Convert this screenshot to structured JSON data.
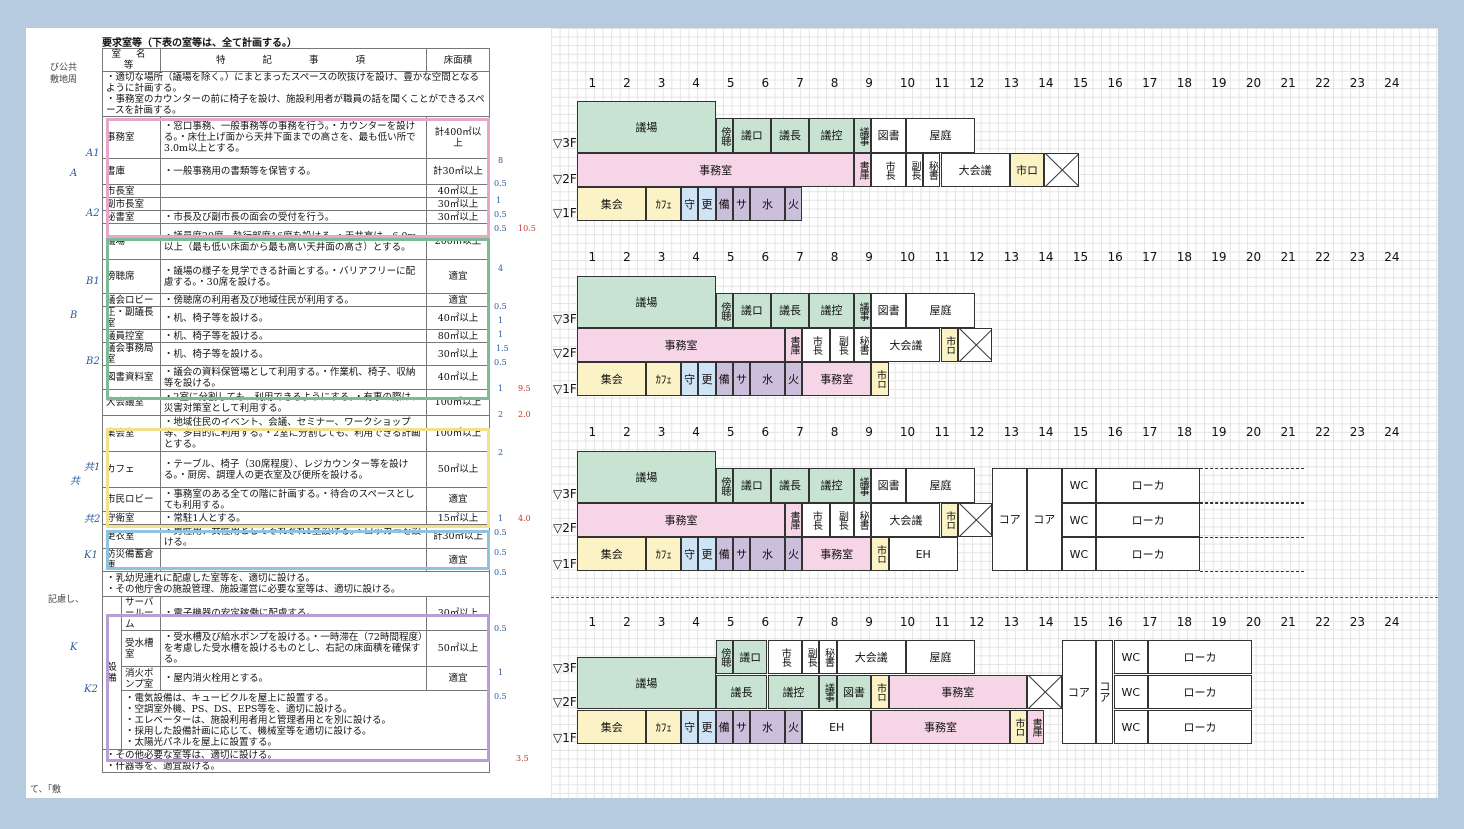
{
  "left": {
    "title": "要求室等（下表の室等は、全て計画する。）",
    "headers": [
      "室 名 等",
      "特　　記　　事　　項",
      "床面積"
    ],
    "intro": [
      "・適切な場所（議場を除く。）にまとまったスペースの吹抜けを設け、豊かな空間となるように計画する。",
      "・事務室のカウンターの前に椅子を設け、施設利用者が職員の話を聞くことができるスペースを計画する。"
    ],
    "rows": [
      {
        "name": "事務室",
        "note": "・窓口事務、一般事務等の事務を行う。・カウンターを設ける。・床仕上げ面から天井下面までの高さを、最も低い所で3.0m以上とする。",
        "area": "計400㎡以上"
      },
      {
        "name": "書庫",
        "note": "・一般事務用の書類等を保管する。",
        "area": "計30㎡以上"
      },
      {
        "name": "市長室",
        "note": "",
        "area": "40㎡以上"
      },
      {
        "name": "副市長室",
        "note": "",
        "area": "30㎡以上"
      },
      {
        "name": "秘書室",
        "note": "・市長及び副市長の面会の受付を行う。",
        "area": "30㎡以上"
      },
      {
        "name": "議場",
        "note": "・議員席20席、執行部席16席を設ける。・天井高は、6.0m以上（最も低い床面から最も高い天井面の高さ）とする。",
        "area": "200㎡以上"
      },
      {
        "name": "傍聴席",
        "note": "・議場の様子を見学できる計画とする。・バリアフリーに配慮する。・30席を設ける。",
        "area": "適宜"
      },
      {
        "name": "議会ロビー",
        "note": "・傍聴席の利用者及び地域住民が利用する。",
        "area": "適宜"
      },
      {
        "name": "正・副議長室",
        "note": "・机、椅子等を設ける。",
        "area": "40㎡以上"
      },
      {
        "name": "議員控室",
        "note": "・机、椅子等を設ける。",
        "area": "80㎡以上"
      },
      {
        "name": "議会事務局室",
        "note": "・机、椅子等を設ける。",
        "area": "30㎡以上"
      },
      {
        "name": "図書資料室",
        "note": "・議会の資料保管場として利用する。・作業机、椅子、収納等を設ける。",
        "area": "40㎡以上"
      },
      {
        "name": "大会議室",
        "note": "・2室に分割しても、利用できるようにする。・有事の際は、災害対策室として利用する。",
        "area": "100㎡以上"
      },
      {
        "name": "集会室",
        "note": "・地域住民のイベント、会議、セミナー、ワークショップ等、多目的に利用する。・2室に分割しても、利用できる計画とする。",
        "area": "100㎡以上"
      },
      {
        "name": "カフェ",
        "note": "・テーブル、椅子（30席程度）、レジカウンター等を設ける。・厨房、調理人の更衣室及び便所を設ける。",
        "area": "50㎡以上"
      },
      {
        "name": "市民ロビー",
        "note": "・事務室のある全ての階に計画する。・待合のスペースとしても利用する。",
        "area": "適宜"
      },
      {
        "name": "守衛室",
        "note": "・常駐1人とする。",
        "area": "15㎡以上"
      },
      {
        "name": "更衣室",
        "note": "・男性用、女性用としてそれぞれ1室設ける。・ロッカーを設ける。",
        "area": "計30㎡以上"
      },
      {
        "name": "防災備蓄倉庫",
        "note": "",
        "area": "適宜"
      }
    ],
    "misc": [
      "・乳幼児連れに配慮した室等を、適切に設ける。",
      "・その他庁舎の施設管理、施設運営に必要な室等は、適切に設ける。"
    ],
    "setsubi_label": "設備",
    "setsubi_rows": [
      {
        "name": "サーバールーム",
        "note": "・電子機器の安定稼働に配慮する。",
        "area": "30㎡以上"
      },
      {
        "name": "受水槽室",
        "note": "・受水槽及び給水ポンプを設ける。・一時滞在（72時間程度）を考慮した受水槽を設けるものとし、右記の床面積を確保する。",
        "area": "50㎡以上"
      },
      {
        "name": "消火ポンプ室",
        "note": "・屋内消火栓用とする。",
        "area": "適宜"
      }
    ],
    "setsubi_notes": [
      "・電気設備は、キュービクルを屋上に設置する。",
      "・空調室外機、PS、DS、EPS等を、適切に設ける。",
      "・エレベーターは、施設利用者用と管理者用とを別に設ける。",
      "・採用した設備計画に応じて、機械室等を適切に設ける。",
      "・太陽光パネルを屋上に設置する。"
    ],
    "footer": [
      "・その他必要な室等は、適切に設ける。",
      "・什器等を、適宜設ける。"
    ],
    "side_text": [
      "び公共",
      "敷地周",
      "記慮し、",
      "て、「敷"
    ],
    "groups": [
      "A1",
      "A",
      "A2",
      "B1",
      "B",
      "B2",
      "共1",
      "共",
      "共2",
      "K1",
      "K",
      "K2"
    ],
    "nums": [
      "8",
      "0.5",
      "1",
      "0.5",
      "0.5",
      "10.5",
      "4",
      "0.5",
      "1",
      "1",
      "1.5",
      "0.5",
      "1",
      "9.5",
      "2",
      "2.0",
      "2",
      "1",
      "4.0",
      "0.5",
      "0.5",
      "0.5",
      "0.5",
      "1",
      "0.5",
      "3.5"
    ]
  },
  "columns": [
    "1",
    "2",
    "3",
    "4",
    "5",
    "6",
    "7",
    "8",
    "9",
    "10",
    "11",
    "12",
    "13",
    "14",
    "15",
    "16",
    "17",
    "18",
    "19",
    "20",
    "21",
    "22",
    "23",
    "24"
  ],
  "floors": [
    "▽3F",
    "▽2F",
    "▽1F"
  ],
  "plans": [
    {
      "id": "p1",
      "rooms": {
        "f3": [
          "議場",
          "傍聴",
          "議ロ",
          "議長",
          "議控",
          "議事",
          "図書",
          "屋庭"
        ],
        "f2": [
          "事務室",
          "書庫",
          "市長",
          "副長",
          "秘書",
          "大会議",
          "市ロ"
        ],
        "f1": [
          "集会",
          "ｶﾌｪ",
          "守",
          "更",
          "備",
          "サ",
          "水",
          "火"
        ]
      }
    },
    {
      "id": "p2",
      "rooms": {
        "f3": [
          "議場",
          "傍聴",
          "議ロ",
          "議長",
          "議控",
          "議事",
          "図書",
          "屋庭"
        ],
        "f2": [
          "事務室",
          "書庫",
          "市長",
          "副長",
          "秘書",
          "大会議",
          "市ロ"
        ],
        "f1": [
          "集会",
          "ｶﾌｪ",
          "守",
          "更",
          "備",
          "サ",
          "水",
          "火",
          "事務室",
          "市ロ"
        ]
      }
    },
    {
      "id": "p3",
      "rooms": {
        "f3": [
          "議場",
          "傍聴",
          "議ロ",
          "議長",
          "議控",
          "議事",
          "図書",
          "屋庭",
          "WC",
          "ローカ"
        ],
        "f2": [
          "事務室",
          "書庫",
          "市長",
          "副長",
          "秘書",
          "大会議",
          "市ロ",
          "コア",
          "コア",
          "WC",
          "ローカ"
        ],
        "f1": [
          "集会",
          "ｶﾌｪ",
          "守",
          "更",
          "備",
          "サ",
          "水",
          "火",
          "事務室",
          "市ロ",
          "EH",
          "WC",
          "ローカ"
        ]
      }
    },
    {
      "id": "p4",
      "rooms": {
        "f3": [
          "傍聴",
          "議ロ",
          "市長",
          "副長",
          "秘書",
          "大会議",
          "屋庭",
          "WC",
          "ローカ"
        ],
        "f2": [
          "議場",
          "議長",
          "議控",
          "議事",
          "図書",
          "市ロ",
          "事務室",
          "コア",
          "コア",
          "WC",
          "ローカ"
        ],
        "f1": [
          "集会",
          "ｶﾌｪ",
          "守",
          "更",
          "備",
          "サ",
          "水",
          "火",
          "EH",
          "事務室",
          "市ロ",
          "書庫"
        ]
      }
    }
  ]
}
